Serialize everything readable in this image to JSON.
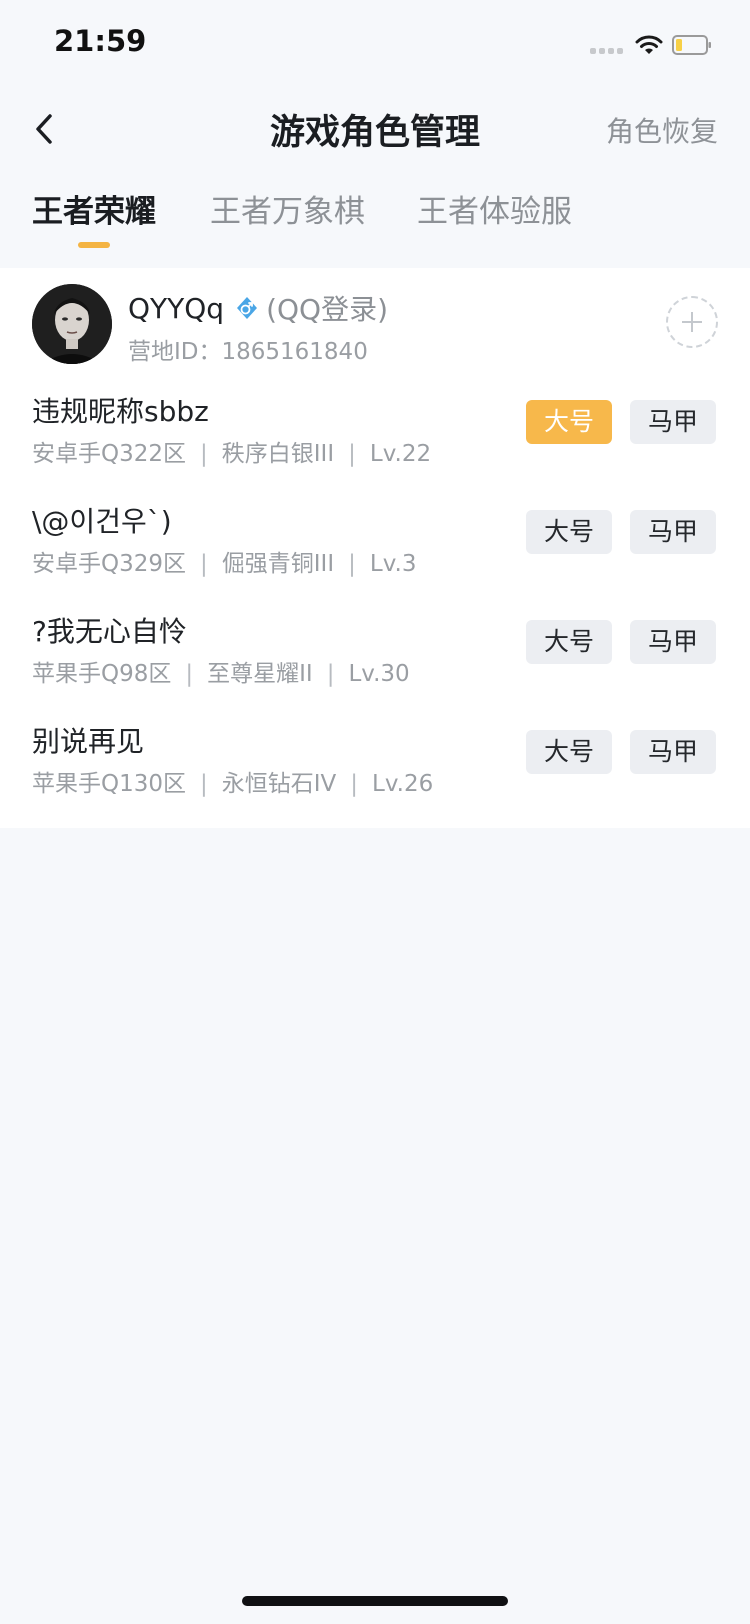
{
  "status_bar": {
    "time": "21:59",
    "battery_color": "#f7d046"
  },
  "header": {
    "back_icon": "chevron-left-icon",
    "title": "游戏角色管理",
    "restore_label": "角色恢复"
  },
  "tabs": [
    {
      "label": "王者荣耀",
      "active": true
    },
    {
      "label": "王者万象棋",
      "active": false
    },
    {
      "label": "王者体验服",
      "active": false
    }
  ],
  "account": {
    "name": "QYYQq",
    "gender_icon": "male-icon",
    "login_type": "(QQ登录)",
    "id_text": "营地ID：1865161840"
  },
  "roles": [
    {
      "name": "违规昵称sbbz",
      "server": "安卓手Q322区",
      "rank": "秩序白银III",
      "level": "Lv.22",
      "main_label": "大号",
      "alt_label": "马甲",
      "main_selected": true
    },
    {
      "name": "\\@이건우`)",
      "server": "安卓手Q329区",
      "rank": "倔强青铜III",
      "level": "Lv.3",
      "main_label": "大号",
      "alt_label": "马甲",
      "main_selected": false
    },
    {
      "name": "?我无心自怜",
      "server": "苹果手Q98区",
      "rank": "至尊星耀II",
      "level": "Lv.30",
      "main_label": "大号",
      "alt_label": "马甲",
      "main_selected": false
    },
    {
      "name": "别说再见",
      "server": "苹果手Q130区",
      "rank": "永恒钻石IV",
      "level": "Lv.26",
      "main_label": "大号",
      "alt_label": "马甲",
      "main_selected": false
    }
  ],
  "colors": {
    "accent": "#f7b84b",
    "background": "#f6f8fb"
  }
}
